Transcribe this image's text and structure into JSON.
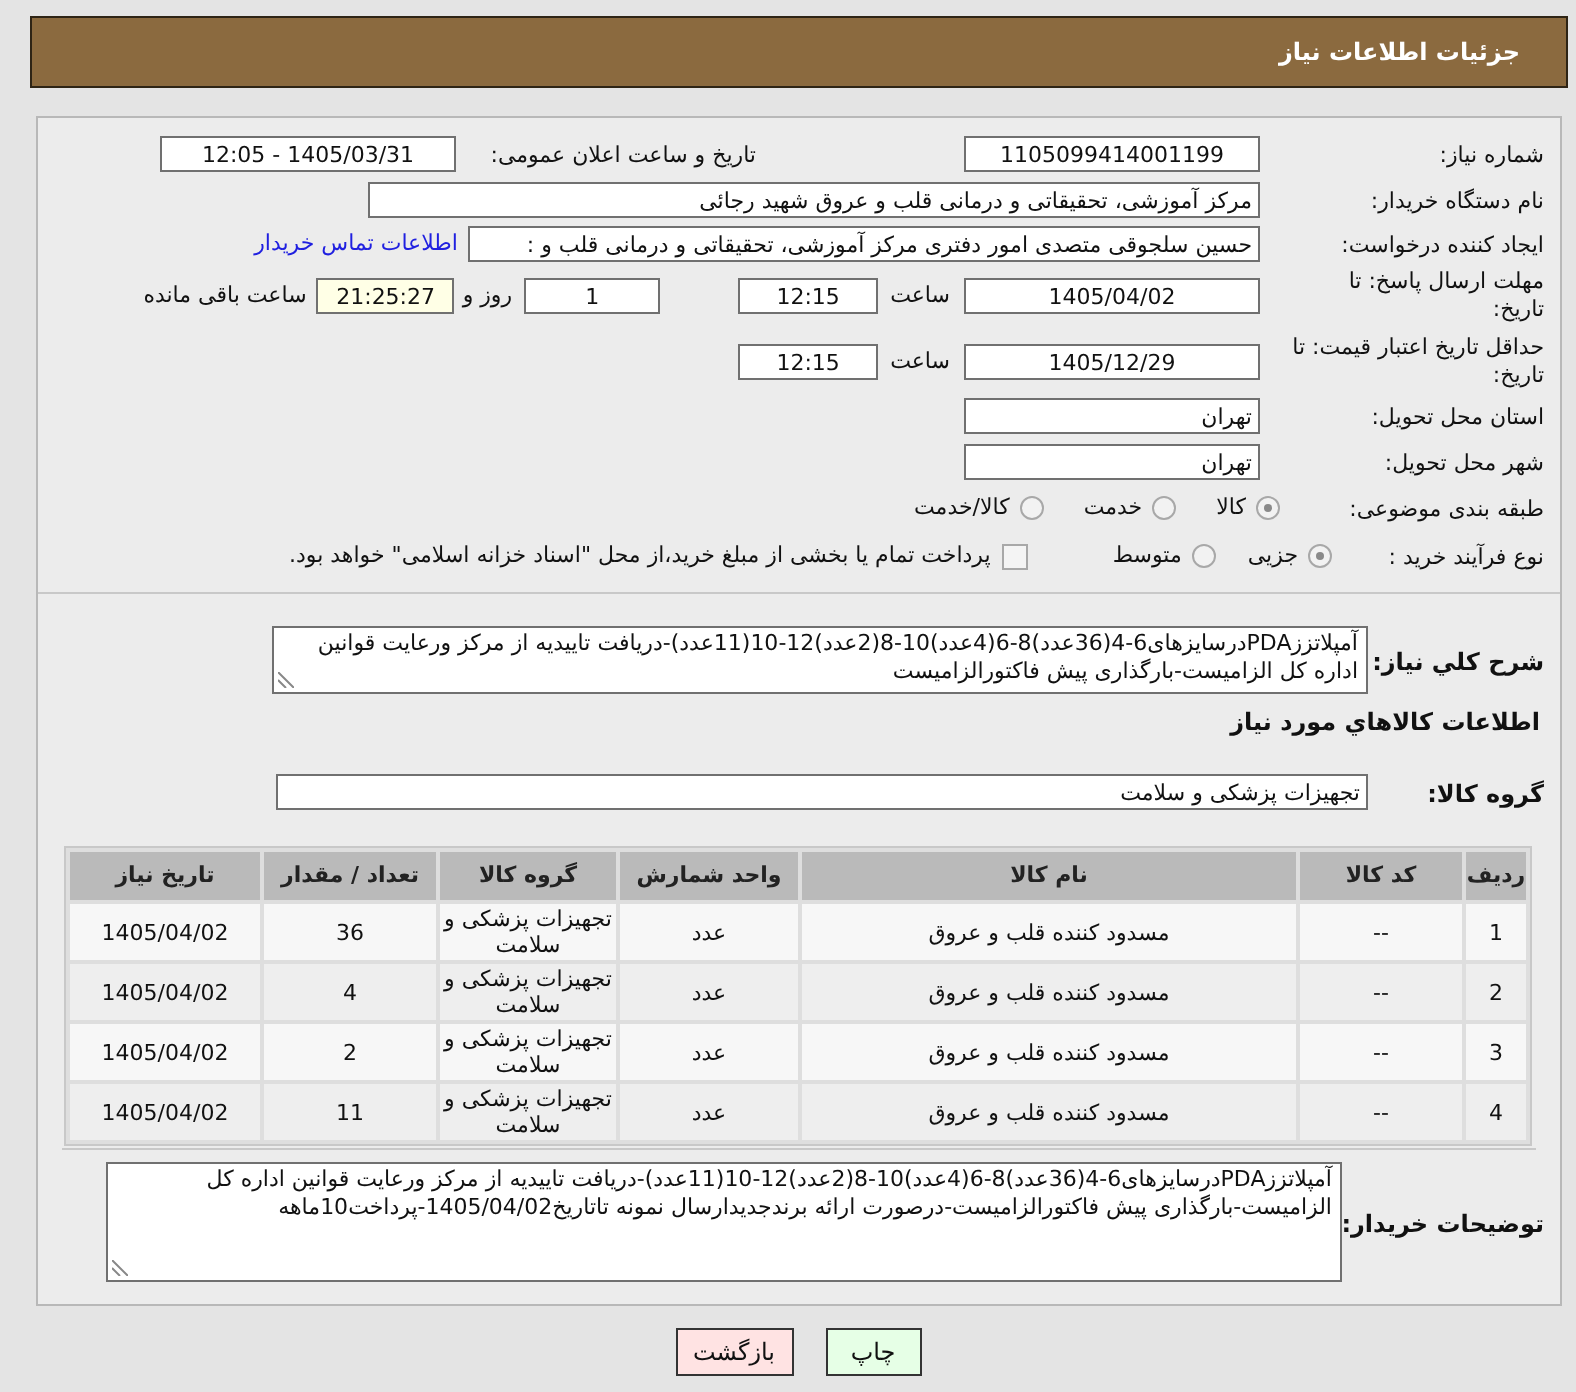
{
  "header": {
    "title": "جزئیات اطلاعات نیاز"
  },
  "need_info": {
    "need_number": {
      "label": "شماره نیاز:",
      "value": "1105099414001199"
    },
    "announce_datetime": {
      "label": "تاریخ و ساعت اعلان عمومی:",
      "value": "1405/03/31 - 12:05"
    },
    "buyer_org": {
      "label": "نام دستگاه خریدار:",
      "value": "مرکز آموزشی، تحقیقاتی و درمانی قلب و عروق شهید رجائی"
    },
    "requester": {
      "label": "ایجاد کننده درخواست:",
      "value": "حسین سلجوقی متصدی امور دفتری مرکز آموزشی، تحقیقاتی و درمانی قلب و :",
      "link": "اطلاعات تماس خریدار"
    },
    "response_deadline": {
      "label": "مهلت ارسال پاسخ: تا تاریخ:",
      "date": "1405/04/02",
      "time_label": "ساعت",
      "time": "12:15",
      "days": "1",
      "days_label": "روز و",
      "remaining": "21:25:27",
      "remaining_label": "ساعت باقی مانده"
    },
    "price_validity": {
      "label": "حداقل تاریخ اعتبار قیمت: تا تاریخ:",
      "date": "1405/12/29",
      "time_label": "ساعت",
      "time": "12:15"
    },
    "delivery_province": {
      "label": "استان محل تحویل:",
      "value": "تهران"
    },
    "delivery_city": {
      "label": "شهر محل تحویل:",
      "value": "تهران"
    },
    "category": {
      "label": "طبقه بندی موضوعی:",
      "options": [
        {
          "label": "کالا",
          "selected": true
        },
        {
          "label": "خدمت",
          "selected": false
        },
        {
          "label": "کالا/خدمت",
          "selected": false
        }
      ]
    },
    "purchase_type": {
      "label": "نوع فرآیند خرید :",
      "options": [
        {
          "label": "جزیی",
          "selected": true
        },
        {
          "label": "متوسط",
          "selected": false
        }
      ],
      "treasury_payment": {
        "label": "پرداخت تمام یا بخشی از مبلغ خرید،از محل \"اسناد خزانه اسلامی\" خواهد بود.",
        "checked": false
      }
    }
  },
  "description": {
    "label": "شرح كلي نياز:",
    "value": "آمپلاتززPDAدرسایزهای6-4(36عدد)8-6(4عدد)10-8(2عدد)12-10(11عدد)-دریافت تاییدیه از مرکز ورعایت قوانین اداره کل الزامیست-بارگذاری پیش فاکتورالزامیست"
  },
  "goods": {
    "title": "اطلاعات كالاهاي مورد نياز",
    "group": {
      "label": "گروه کالا:",
      "value": "تجهیزات پزشکی و سلامت"
    },
    "table": {
      "columns": [
        "ردیف",
        "کد کالا",
        "نام کالا",
        "واحد شمارش",
        "گروه کالا",
        "تعداد / مقدار",
        "تاریخ نیاز"
      ],
      "rows": [
        [
          "1",
          "--",
          "مسدود کننده قلب و عروق",
          "عدد",
          "تجهیزات پزشکی و سلامت",
          "36",
          "1405/04/02"
        ],
        [
          "2",
          "--",
          "مسدود کننده قلب و عروق",
          "عدد",
          "تجهیزات پزشکی و سلامت",
          "4",
          "1405/04/02"
        ],
        [
          "3",
          "--",
          "مسدود کننده قلب و عروق",
          "عدد",
          "تجهیزات پزشکی و سلامت",
          "2",
          "1405/04/02"
        ],
        [
          "4",
          "--",
          "مسدود کننده قلب و عروق",
          "عدد",
          "تجهیزات پزشکی و سلامت",
          "11",
          "1405/04/02"
        ]
      ]
    }
  },
  "buyer_notes": {
    "label": "توضیحات خریدار:",
    "value": "آمپلاتززPDAدرسایزهای6-4(36عدد)8-6(4عدد)10-8(2عدد)12-10(11عدد)-دریافت تاییدیه از مرکز ورعایت قوانین اداره کل الزامیست-بارگذاری پیش فاکتورالزامیست-درصورت ارائه برندجدیدارسال نمونه تاتاریخ1405/04/02-پرداخت10ماهه"
  },
  "buttons": [
    {
      "label": "چاپ",
      "kind": "print"
    },
    {
      "label": "بازگشت",
      "kind": "back"
    }
  ]
}
